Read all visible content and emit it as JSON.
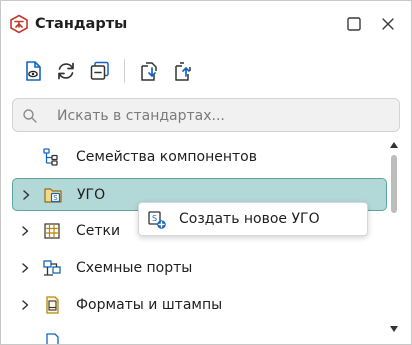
{
  "header": {
    "title": "Стандарты",
    "app_icon": "standards-logo-icon",
    "buttons": [
      "maximize-icon",
      "close-icon"
    ]
  },
  "toolbar": {
    "buttons": [
      "view-document-icon",
      "refresh-icon",
      "collapse-all-icon",
      "import-icon",
      "export-icon"
    ]
  },
  "search": {
    "placeholder": "Искать в стандартах..."
  },
  "tree": {
    "items": [
      {
        "label": "Семейства компонентов",
        "icon": "component-families-icon",
        "expandable": false,
        "selected": false
      },
      {
        "label": "УГО",
        "icon": "symbol-folder-icon",
        "expandable": true,
        "selected": true
      },
      {
        "label": "Сетки",
        "icon": "grid-icon",
        "expandable": true,
        "selected": false
      },
      {
        "label": "Схемные порты",
        "icon": "schematic-ports-icon",
        "expandable": true,
        "selected": false
      },
      {
        "label": "Форматы и штампы",
        "icon": "formats-stamps-icon",
        "expandable": true,
        "selected": false
      }
    ]
  },
  "context_menu": {
    "item_label": "Создать новое УГО",
    "item_icon": "create-symbol-icon"
  },
  "colors": {
    "accent_red": "#c0392b",
    "accent_blue": "#1565c0",
    "selection_bg": "#b2d8d7",
    "selection_border": "#5fa3a3"
  }
}
